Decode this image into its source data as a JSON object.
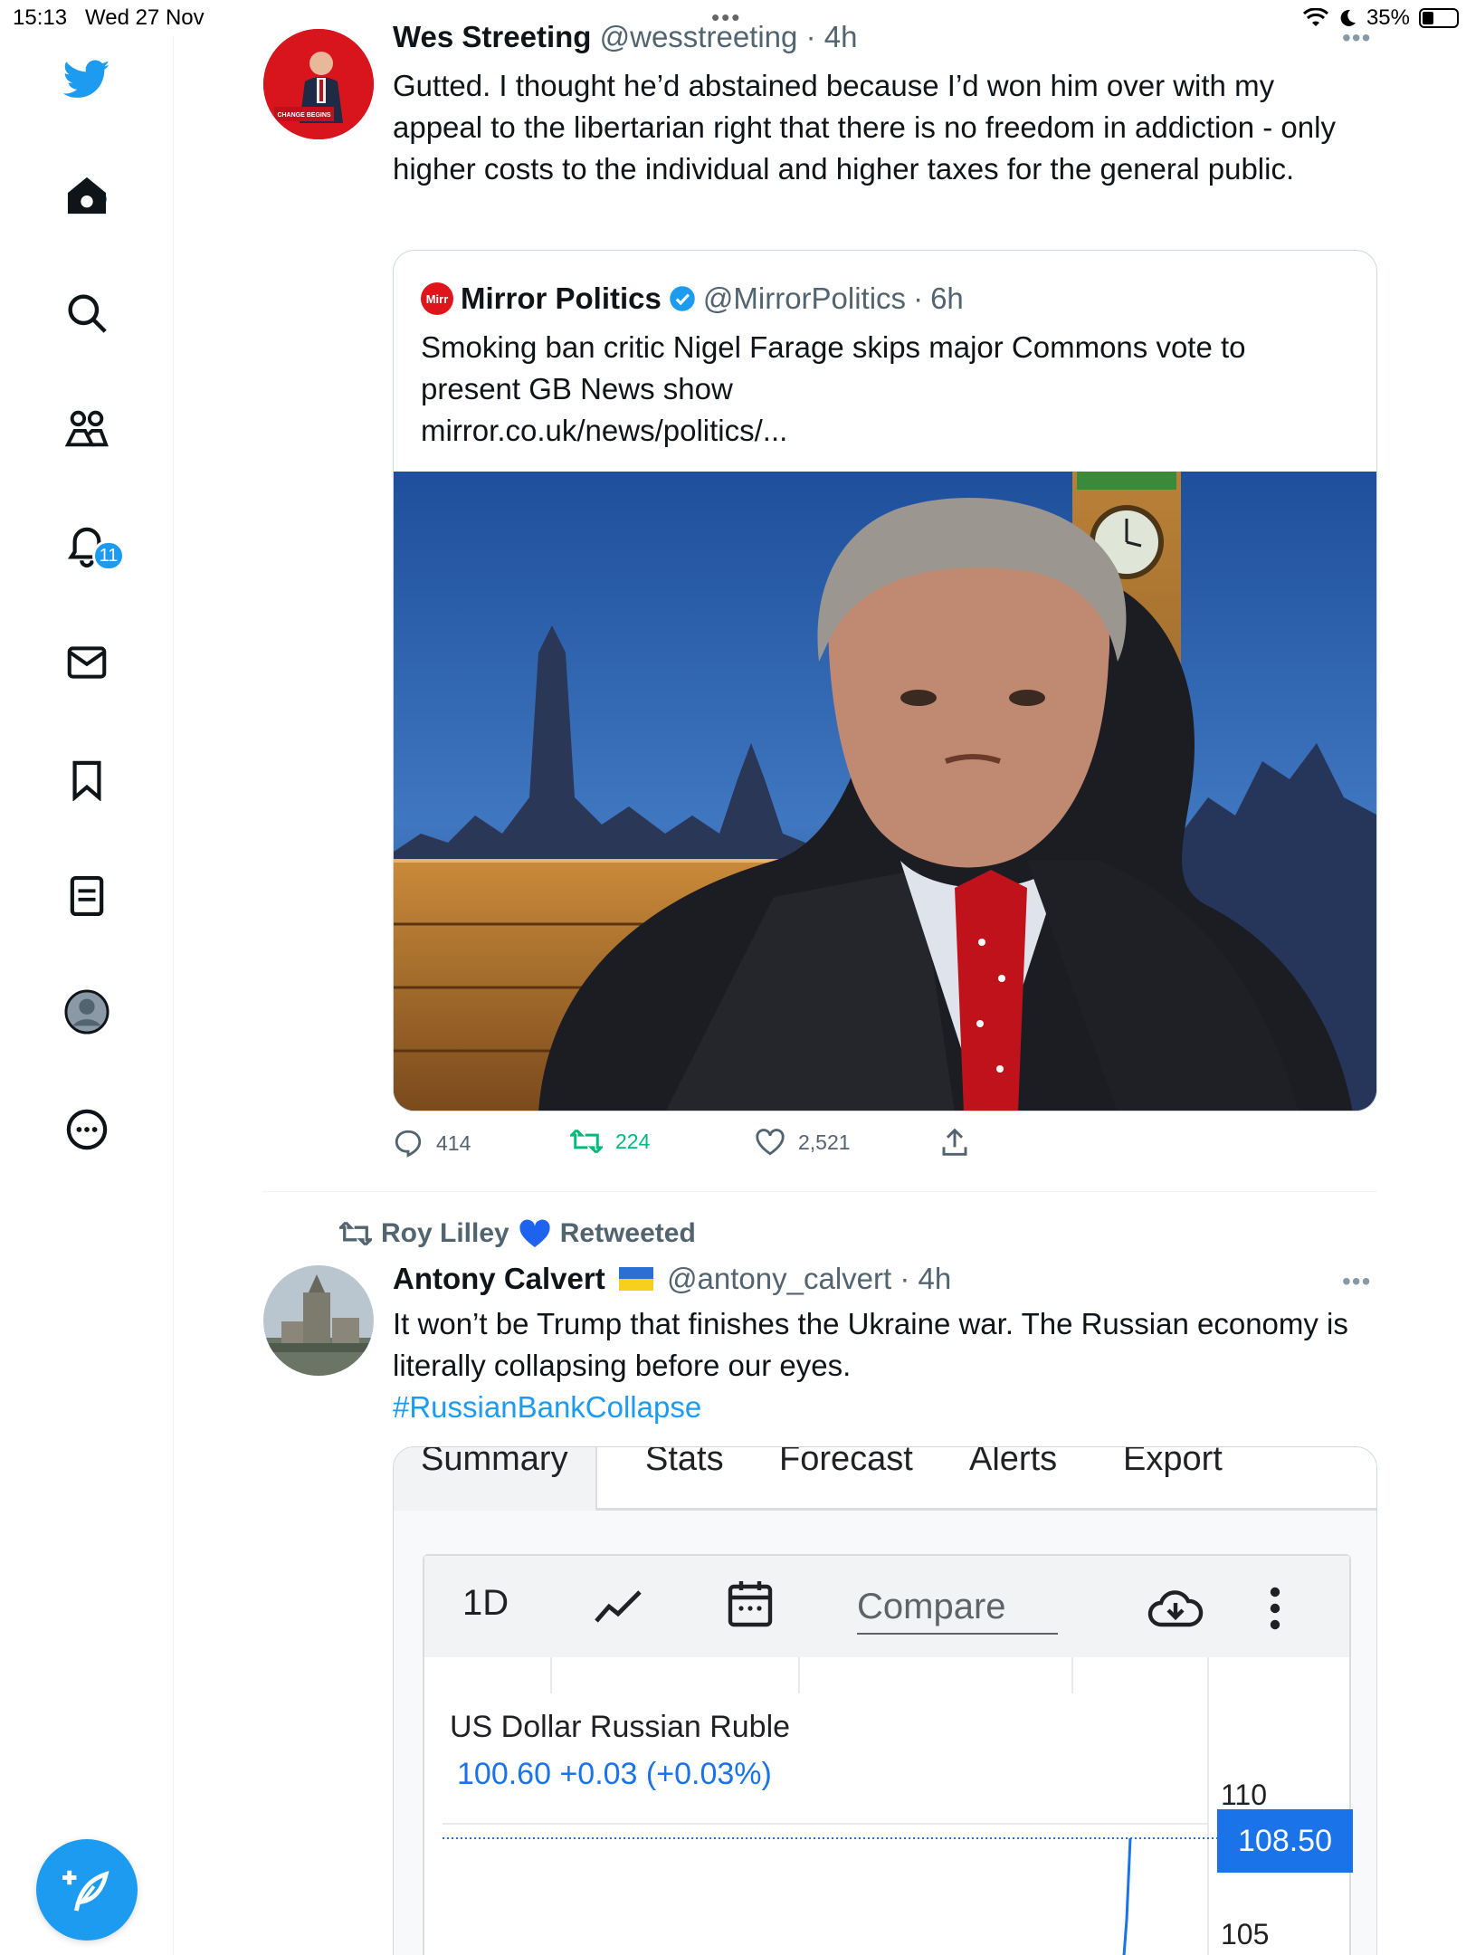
{
  "status_bar": {
    "time": "15:13",
    "date": "Wed 27 Nov",
    "battery": "35%"
  },
  "sidebar": {
    "items": [
      {
        "name": "home",
        "icon": "home-icon"
      },
      {
        "name": "explore",
        "icon": "search-icon"
      },
      {
        "name": "communities",
        "icon": "communities-icon"
      },
      {
        "name": "notifications",
        "icon": "bell-icon",
        "badge": "11"
      },
      {
        "name": "messages",
        "icon": "mail-icon"
      },
      {
        "name": "bookmarks",
        "icon": "bookmark-icon"
      },
      {
        "name": "lists",
        "icon": "list-icon"
      },
      {
        "name": "profile",
        "icon": "profile-icon"
      },
      {
        "name": "more",
        "icon": "more-icon"
      }
    ],
    "compose_icon": "feather-plus-icon"
  },
  "tweet1": {
    "name": "Wes Streeting",
    "handle": "@wesstreeting",
    "time": "4h",
    "text": "Gutted. I thought he’d abstained because  I’d won him over with my appeal to the libertarian right that there is no freedom in addiction - only higher costs to the individual and higher taxes for the general public.",
    "avatar_caption": "CHANGE BEGINS",
    "quote": {
      "name": "Mirror Politics",
      "handle": "@MirrorPolitics",
      "time": "6h",
      "logo_text": "Mirr",
      "text": "Smoking ban critic Nigel Farage skips major Commons vote to present GB News show",
      "link": "mirror.co.uk/news/politics/..."
    },
    "stats": {
      "replies": "414",
      "retweets": "224",
      "likes": "2,521"
    }
  },
  "tweet2": {
    "retweeted_by": "Roy Lilley",
    "retweeted_label": "Retweeted",
    "name": "Antony Calvert",
    "handle": "@antony_calvert",
    "time": "4h",
    "text": "It won’t be Trump that finishes the Ukraine war. The Russian economy is literally collapsing before our eyes.",
    "hashtag": "#RussianBankCollapse",
    "media": {
      "tabs": [
        "Summary",
        "Stats",
        "Forecast",
        "Alerts",
        "Export"
      ],
      "active_tab": "Summary",
      "toolbar_range": "1D",
      "compare_label": "Compare",
      "pair_title": "US Dollar Russian Ruble",
      "pair_value": "100.60  +0.03 (+0.03%)",
      "ticks": [
        "110",
        "105"
      ],
      "price_tag": "108.50"
    }
  },
  "colors": {
    "accent": "#1d9bf0",
    "retweet_green": "#00ba7c",
    "finance_blue": "#1a73e8"
  }
}
